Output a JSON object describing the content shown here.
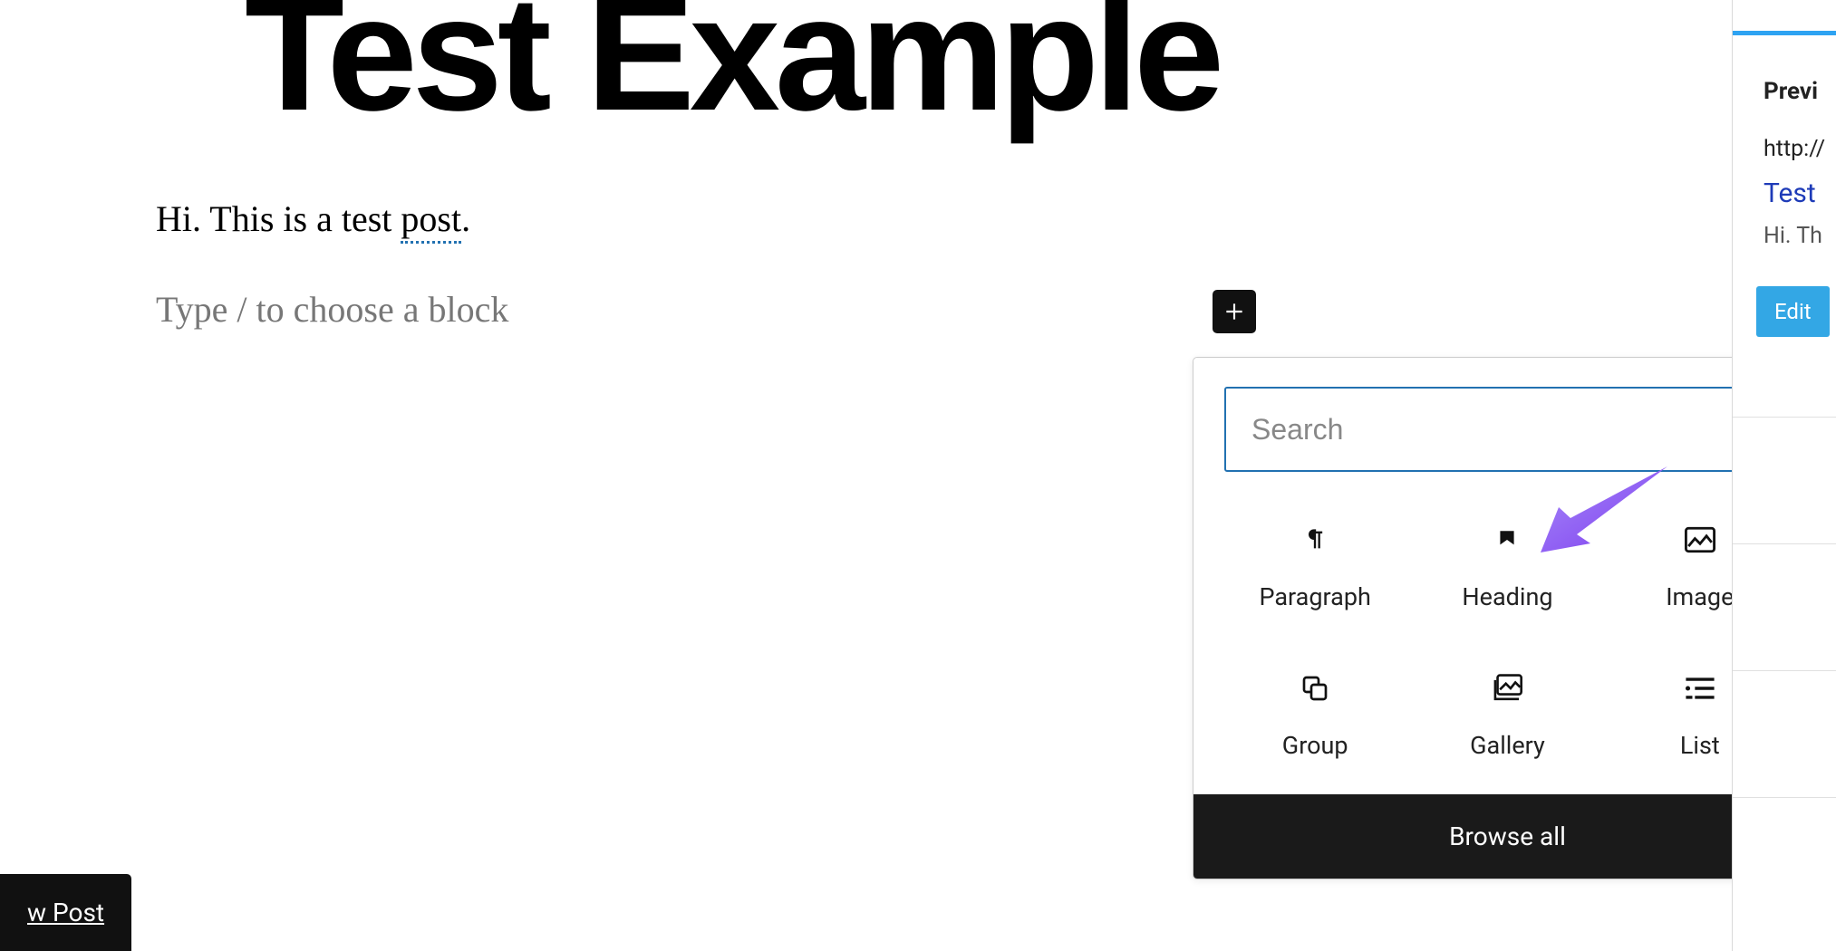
{
  "post": {
    "title": "Test Example",
    "body_plain_prefix": "Hi. This is a test ",
    "body_squiggle": "post",
    "body_plain_suffix": ".",
    "placeholder": "Type / to choose a block"
  },
  "inserter": {
    "search_placeholder": "Search",
    "blocks": {
      "paragraph": "Paragraph",
      "heading": "Heading",
      "image": "Image",
      "group": "Group",
      "gallery": "Gallery",
      "list": "List"
    },
    "browse_all": "Browse all"
  },
  "sidebar": {
    "preview_heading": "Previ",
    "url_fragment": "http://",
    "title_fragment": "Test ",
    "excerpt_fragment": "Hi. Th",
    "edit_label": "Edit"
  },
  "floating": {
    "label": "w Post"
  },
  "icons": {
    "add": "plus-icon",
    "search": "search-icon",
    "paragraph": "pilcrow-icon",
    "heading": "heading-icon",
    "image": "image-icon",
    "group": "group-icon",
    "gallery": "gallery-icon",
    "list": "list-icon"
  },
  "colors": {
    "accent": "#2271b1",
    "arrow": "#8b5cf6",
    "button": "#33a7e5"
  }
}
